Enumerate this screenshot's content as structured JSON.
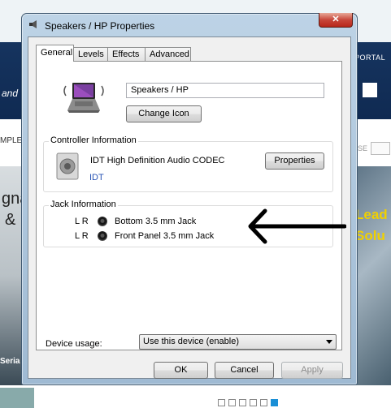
{
  "background": {
    "fragments": {
      "and": "and",
      "portal": "PORTAL",
      "mple": "MPLE",
      "se": "SE",
      "gna": "gna",
      "amp": "&",
      "seria": "Seria",
      "lead": "Lead",
      "solu": "Solu"
    },
    "pager_count": 6,
    "pager_active": 5
  },
  "dialog": {
    "title": "Speakers / HP Properties",
    "close_label": "✕",
    "tabs": [
      {
        "label": "General",
        "active": true
      },
      {
        "label": "Levels",
        "active": false
      },
      {
        "label": "Effects",
        "active": false
      },
      {
        "label": "Advanced",
        "active": false
      }
    ],
    "device_name": "Speakers / HP",
    "change_icon_label": "Change Icon",
    "controller": {
      "group_label": "Controller Information",
      "name": "IDT High Definition Audio CODEC",
      "vendor_link": "IDT",
      "properties_label": "Properties"
    },
    "jack": {
      "group_label": "Jack Information",
      "rows": [
        {
          "channels": "L R",
          "label": "Bottom 3.5 mm Jack"
        },
        {
          "channels": "L R",
          "label": "Front Panel 3.5 mm Jack"
        }
      ]
    },
    "usage": {
      "label": "Device usage:",
      "value": "Use this device (enable)"
    },
    "buttons": {
      "ok": "OK",
      "cancel": "Cancel",
      "apply": "Apply"
    }
  }
}
